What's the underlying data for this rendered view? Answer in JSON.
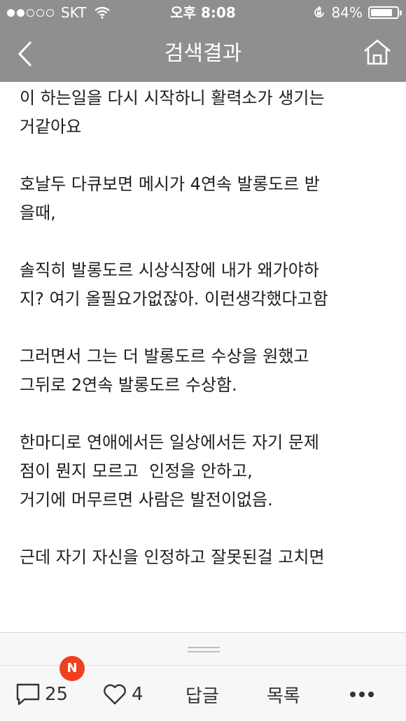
{
  "status_bar": {
    "carrier": "SKT",
    "time": "오후 8:08",
    "battery_percent": "84%",
    "battery_level": 0.84,
    "signal_bars_filled": 2,
    "signal_bars_total": 5
  },
  "nav": {
    "title": "검색결과",
    "back_icon": "chevron-left-icon",
    "home_icon": "home-icon"
  },
  "content": {
    "paragraphs": [
      "이 하는일을 다시 시작하니 활력소가 생기는\n거같아요",
      "호날두 다큐보면 메시가 4연속 발롱도르 받\n을때,",
      "솔직히 발롱도르 시상식장에 내가 왜가야하\n지? 여기 올필요가없잖아. 이런생각했다고함",
      "그러면서 그는 더 발롱도르 수상을 원했고\n그뒤로 2연속 발롱도르 수상함.",
      "한마디로 연애에서든 일상에서든 자기 문제\n점이 뭔지 모르고  인정을 안하고,\n거기에 머무르면 사람은 발전이없음.",
      "근데 자기 자신을 인정하고 잘못된걸 고치면"
    ]
  },
  "toolbar": {
    "comment_count": "25",
    "like_count": "4",
    "reply_label": "답글",
    "list_label": "목록",
    "new_badge": "N",
    "accent_color": "#f0401e"
  }
}
